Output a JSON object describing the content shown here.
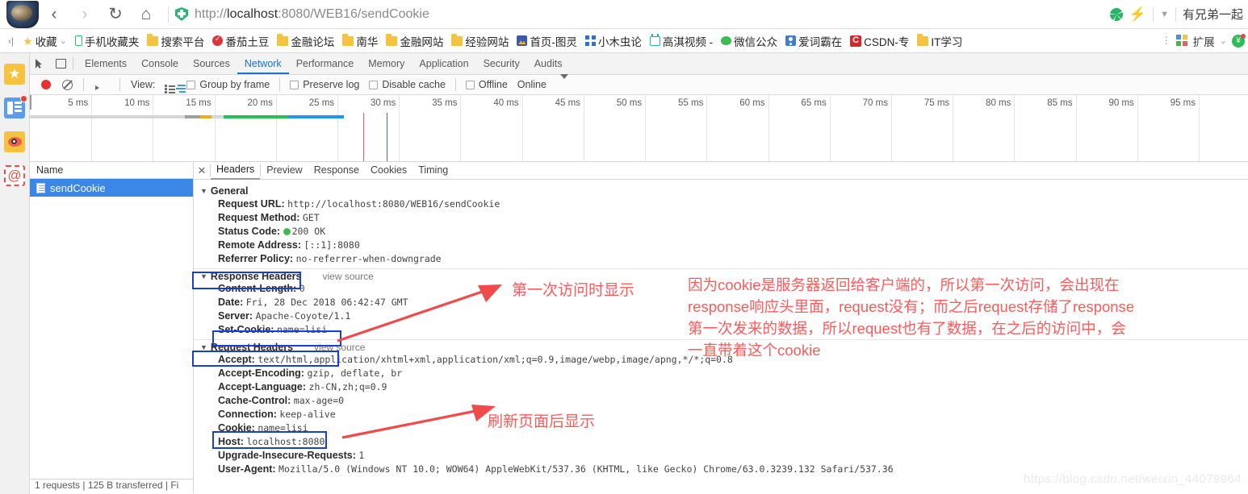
{
  "browser": {
    "url_scheme": "http://",
    "url_host": "localhost",
    "url_rest": ":8080/WEB16/sendCookie",
    "back_icon": "back-arrow-icon",
    "forward_icon": "forward-arrow-icon",
    "reload_icon": "reload-icon",
    "home_icon": "home-icon",
    "shield_icon": "security-shield-icon",
    "right_text": "有兄弟一起",
    "ext_label": "扩展"
  },
  "bookmarks": {
    "overflow_label": "‹|",
    "items": [
      {
        "label": "收藏",
        "icon": "star-icon",
        "caret": true
      },
      {
        "label": "手机收藏夹",
        "icon": "phone-icon"
      },
      {
        "label": "搜索平台",
        "icon": "folder-icon"
      },
      {
        "label": "番茄土豆",
        "icon": "tomato-check-icon"
      },
      {
        "label": "金融论坛",
        "icon": "folder-icon"
      },
      {
        "label": "南华",
        "icon": "folder-icon"
      },
      {
        "label": "金融网站",
        "icon": "folder-icon"
      },
      {
        "label": "经验网站",
        "icon": "folder-icon"
      },
      {
        "label": "首页-图灵",
        "icon": "ling-icon"
      },
      {
        "label": "小木虫论",
        "icon": "blue-dots-icon"
      },
      {
        "label": "高淇视频 -",
        "icon": "video-icon"
      },
      {
        "label": "微信公众",
        "icon": "wechat-icon"
      },
      {
        "label": "爱词霸在",
        "icon": "ciba-icon"
      },
      {
        "label": "CSDN-专",
        "icon": "csdn-icon"
      },
      {
        "label": "IT学习",
        "icon": "folder-icon"
      }
    ]
  },
  "sidebar": {
    "items": [
      {
        "name": "favorites",
        "icon": "star-icon"
      },
      {
        "name": "news",
        "icon": "news-panel-icon",
        "badge": true
      },
      {
        "name": "weibo",
        "icon": "weibo-eye-icon"
      },
      {
        "name": "mail",
        "icon": "at-email-icon"
      }
    ]
  },
  "devtools": {
    "tabs": [
      "Elements",
      "Console",
      "Sources",
      "Network",
      "Performance",
      "Memory",
      "Application",
      "Security",
      "Audits"
    ],
    "active_tab": "Network",
    "inspect_icon": "inspect-cursor-icon",
    "device_icon": "device-toolbar-icon",
    "toolbar": {
      "record_icon": "record-button-icon",
      "clear_icon": "clear-icon",
      "capture_icon": "capture-screenshots-icon",
      "filter_icon": "filter-icon",
      "view_label": "View:",
      "list_view_icon": "list-view-icon",
      "waterfall_view_icon": "waterfall-view-icon",
      "group_by_frame": "Group by frame",
      "preserve_log": "Preserve log",
      "disable_cache": "Disable cache",
      "offline": "Offline",
      "throttle_value": "Online",
      "more_icon": "chevron-down-icon"
    }
  },
  "timeline": {
    "ticks": [
      "5 ms",
      "10 ms",
      "15 ms",
      "20 ms",
      "25 ms",
      "30 ms",
      "35 ms",
      "40 ms",
      "45 ms",
      "50 ms",
      "55 ms",
      "60 ms",
      "65 ms",
      "70 ms",
      "75 ms",
      "80 ms",
      "85 ms",
      "90 ms",
      "95 ms"
    ],
    "bar_segments": [
      {
        "name": "queueing",
        "color": "#d6d6d6",
        "start_pct": 0.0,
        "width_pct": 12.7
      },
      {
        "name": "stalled",
        "color": "#9e9e9e",
        "start_pct": 12.7,
        "width_pct": 1.3
      },
      {
        "name": "waiting",
        "color": "#f5a623",
        "start_pct": 14.0,
        "width_pct": 0.9
      },
      {
        "name": "gap",
        "color": "#d6d6d6",
        "start_pct": 14.9,
        "width_pct": 1.0
      },
      {
        "name": "content-download",
        "color": "#25c154",
        "start_pct": 15.9,
        "width_pct": 5.3
      },
      {
        "name": "receiving",
        "color": "#2196f3",
        "start_pct": 21.2,
        "width_pct": 4.6
      }
    ],
    "markers": [
      {
        "name": "dom-content-loaded",
        "color": "#ef5b5b",
        "pos_pct": 27.4
      },
      {
        "name": "load-event",
        "color": "#4a5bd0",
        "pos_pct": 29.3
      }
    ]
  },
  "request_list": {
    "column_header": "Name",
    "rows": [
      {
        "label": "sendCookie",
        "icon": "document-icon",
        "selected": true
      }
    ],
    "status": "1 requests | 125 B transferred | Fi"
  },
  "detail": {
    "close_icon": "close-icon",
    "tabs": [
      "Headers",
      "Preview",
      "Response",
      "Cookies",
      "Timing"
    ],
    "active_tab": "Headers",
    "sections": [
      {
        "title": "General",
        "view_source": "",
        "rows": [
          {
            "key": "Request URL:",
            "value": "http://localhost:8080/WEB16/sendCookie"
          },
          {
            "key": "Request Method:",
            "value": "GET"
          },
          {
            "key": "Status Code:",
            "value": "200 OK",
            "status_dot": true
          },
          {
            "key": "Remote Address:",
            "value": "[::1]:8080"
          },
          {
            "key": "Referrer Policy:",
            "value": "no-referrer-when-downgrade"
          }
        ]
      },
      {
        "title": "Response Headers",
        "view_source": "view source",
        "rows": [
          {
            "key": "Content-Length:",
            "value": "0"
          },
          {
            "key": "Date:",
            "value": "Fri, 28 Dec 2018 06:42:47 GMT"
          },
          {
            "key": "Server:",
            "value": "Apache-Coyote/1.1"
          },
          {
            "key": "Set-Cookie:",
            "value": "name=lisi"
          }
        ]
      },
      {
        "title": "Request Headers",
        "view_source": "view source",
        "rows": [
          {
            "key": "Accept:",
            "value": "text/html,application/xhtml+xml,application/xml;q=0.9,image/webp,image/apng,*/*;q=0.8"
          },
          {
            "key": "Accept-Encoding:",
            "value": "gzip, deflate, br"
          },
          {
            "key": "Accept-Language:",
            "value": "zh-CN,zh;q=0.9"
          },
          {
            "key": "Cache-Control:",
            "value": "max-age=0"
          },
          {
            "key": "Connection:",
            "value": "keep-alive"
          },
          {
            "key": "Cookie:",
            "value": "name=lisi"
          },
          {
            "key": "Host:",
            "value": "localhost:8080"
          },
          {
            "key": "Upgrade-Insecure-Requests:",
            "value": "1"
          },
          {
            "key": "User-Agent:",
            "value": "Mozilla/5.0 (Windows NT 10.0; WOW64) AppleWebKit/537.36 (KHTML, like Gecko) Chrome/63.0.3239.132 Safari/537.36"
          }
        ]
      }
    ]
  },
  "annotations": {
    "accent_color": "#ff5a5a",
    "box_color": "#1a3fd8",
    "first_visit": "第一次访问时显示",
    "after_refresh": "刷新页面后显示",
    "paragraph_lines": [
      "因为cookie是服务器返回给客户端的，所以第一次访问，会出现在",
      "response响应头里面，request没有；而之后request存储了response",
      "第一次发来的数据，所以request也有了数据，在之后的访问中，会",
      "一直带着这个cookie"
    ]
  },
  "watermark": "https://blog.csdn.net/weixin_44079964"
}
